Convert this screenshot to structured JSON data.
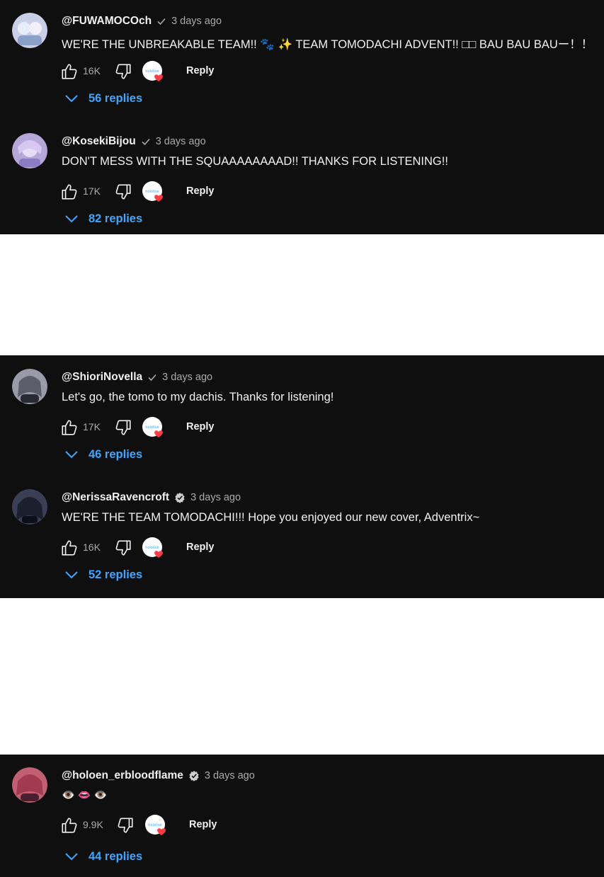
{
  "comments": [
    {
      "handle": "@FUWAMOCOch",
      "badge": "check-icon",
      "time": "3 days ago",
      "text": "WE'RE THE UNBREAKABLE TEAM!! 🐾 ✨ TEAM TOMODACHI ADVENT!! □□ BAU BAU BAUー！！",
      "likes": "16K",
      "reply_label": "Reply",
      "replies_label": "56 replies",
      "avatar_color": "#c9cfe6"
    },
    {
      "handle": "@KosekiBijou",
      "badge": "check-icon",
      "time": "3 days ago",
      "text": "DON'T MESS WITH THE SQUAAAAAAAAD!! THANKS FOR LISTENING!!",
      "likes": "17K",
      "reply_label": "Reply",
      "replies_label": "82 replies",
      "avatar_color": "#b7a6d8"
    },
    {
      "handle": "@ShioriNovella",
      "badge": "check-icon",
      "time": "3 days ago",
      "text": "Let's go, the tomo to my dachis. Thanks for listening!",
      "likes": "17K",
      "reply_label": "Reply",
      "replies_label": "46 replies",
      "avatar_color": "#9a9aa8"
    },
    {
      "handle": "@NerissaRavencroft",
      "badge": "verified-icon",
      "time": "3 days ago",
      "text": "WE'RE THE TEAM TOMODACHI!!! Hope you enjoyed our new cover, Adventrix~",
      "likes": "16K",
      "reply_label": "Reply",
      "replies_label": "52 replies",
      "avatar_color": "#3a3f55"
    },
    {
      "handle": "@holoen_erbloodflame",
      "badge": "verified-icon",
      "time": "3 days ago",
      "text": "👁️ 👄 👁️",
      "likes": "9.9K",
      "reply_label": "Reply",
      "replies_label": "44 replies",
      "avatar_color": "#c06070"
    }
  ],
  "colors": {
    "background": "#0f0f0f",
    "link_blue": "#3ea6ff",
    "muted": "#aaaaaa",
    "heart": "#ff3b47"
  }
}
